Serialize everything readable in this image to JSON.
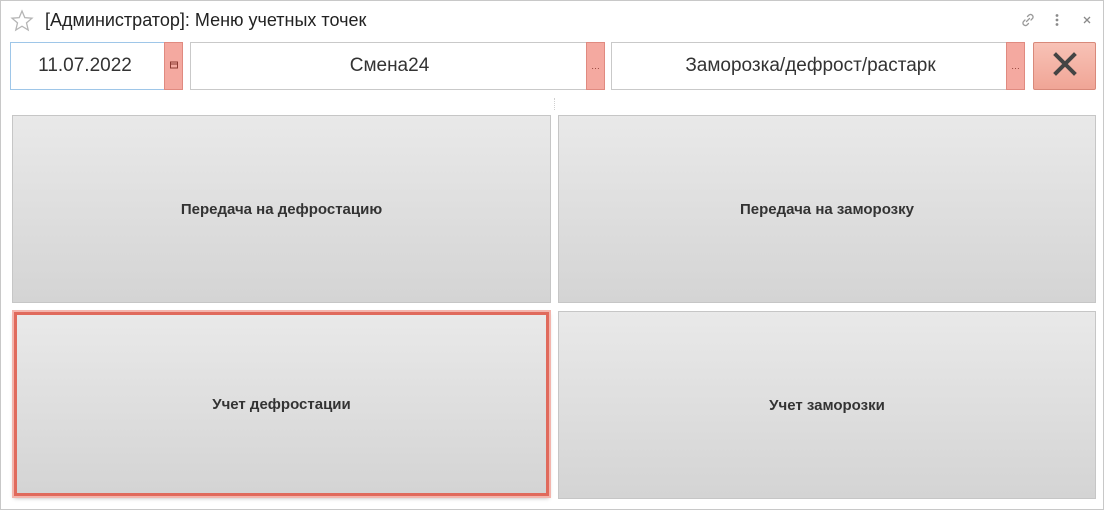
{
  "window": {
    "title": "[Администратор]: Меню учетных точек",
    "icons": {
      "favorite": "star-icon",
      "link": "link-icon",
      "more": "more-vertical-icon",
      "close": "close-icon"
    }
  },
  "filters": {
    "date": {
      "value": "11.07.2022",
      "button_icon": "calendar-icon"
    },
    "shift": {
      "value": "Смена24",
      "button_icon": "ellipsis-icon"
    },
    "operation": {
      "value": "Заморозка/дефрост/растарк",
      "button_icon": "ellipsis-icon"
    },
    "close_button_icon": "close-x-icon"
  },
  "actions": [
    {
      "label": "Передача на дефростацию"
    },
    {
      "label": "Передача на заморозку"
    },
    {
      "label": "Учет дефростации",
      "highlighted": true
    },
    {
      "label": "Учет заморозки"
    }
  ],
  "colors": {
    "accent_highlight": "#e06a5c",
    "select_button": "#f4a9a0"
  }
}
